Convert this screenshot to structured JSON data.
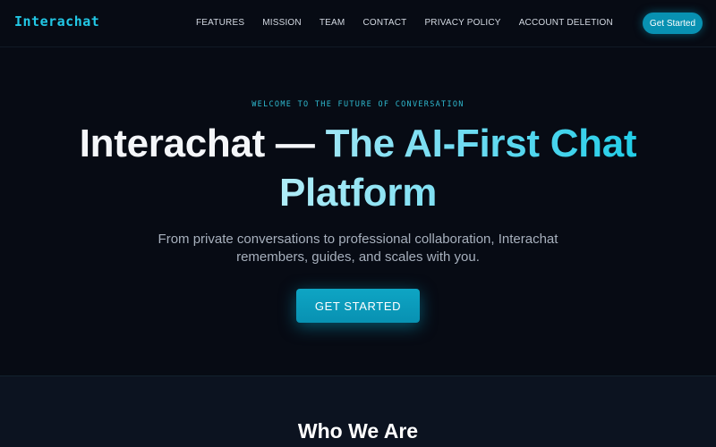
{
  "brand": {
    "name": "Interachat",
    "accent": "#0891b2",
    "logo_color": "#22c8e6"
  },
  "nav": {
    "links": [
      "FEATURES",
      "MISSION",
      "TEAM",
      "CONTACT",
      "PRIVACY POLICY",
      "ACCOUNT DELETION"
    ],
    "cta_label": "Get Started"
  },
  "hero": {
    "eyebrow": "WELCOME TO THE FUTURE OF CONVERSATION",
    "headline_white": "Interachat — ",
    "headline_gradient_1": "The AI-First Chat",
    "headline_gradient_2": "Platform",
    "subtitle": "From private conversations to professional collaboration, Interachat remembers, guides, and scales with you.",
    "cta_label": "GET STARTED"
  },
  "about": {
    "title": "Who We Are"
  }
}
